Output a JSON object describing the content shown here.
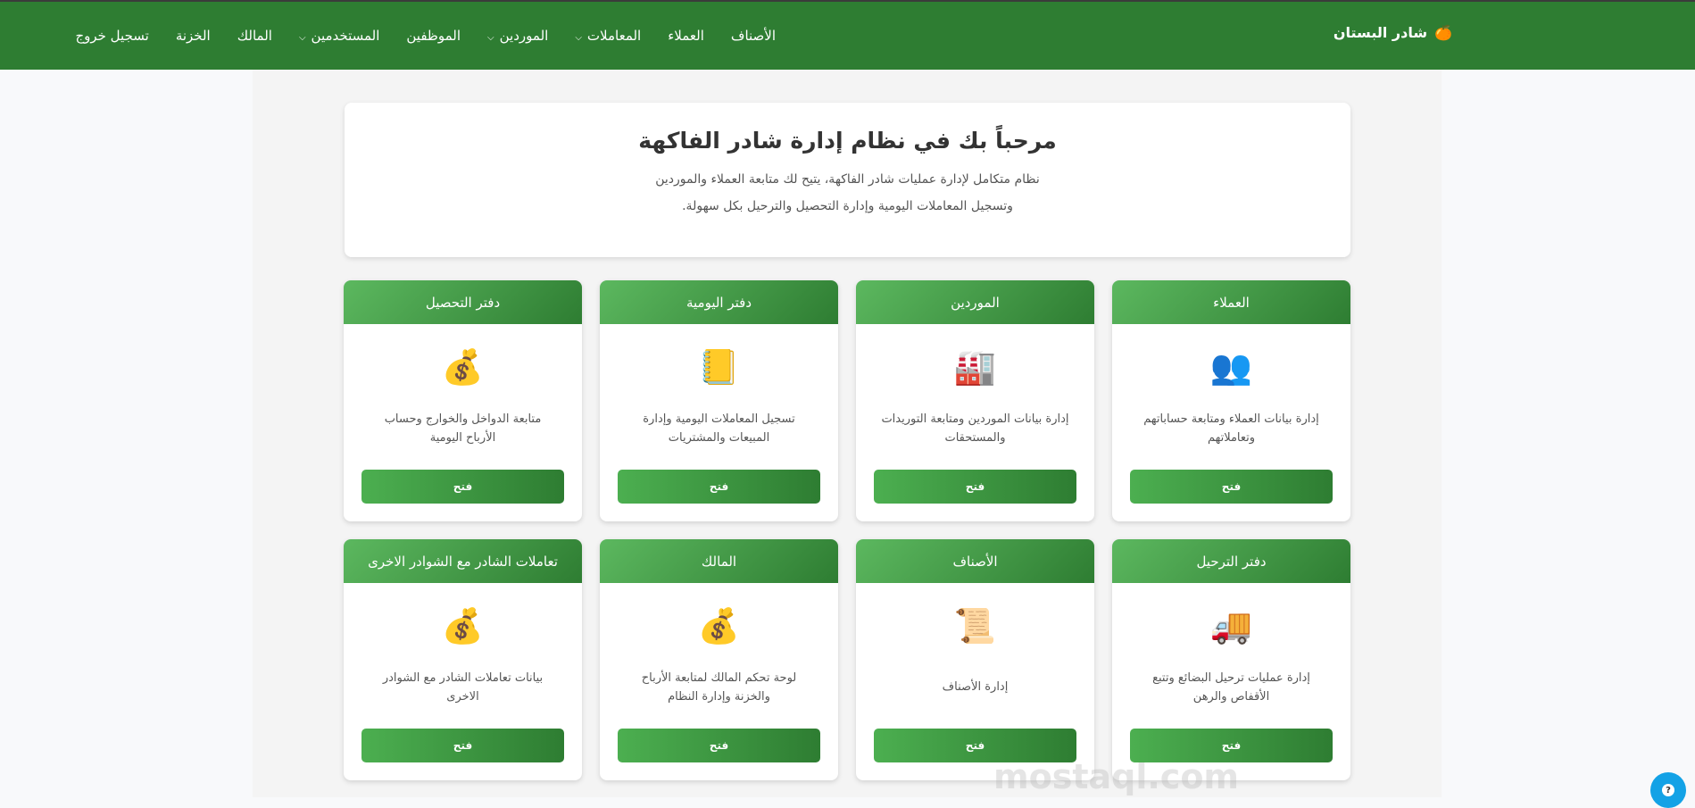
{
  "brand": {
    "icon": "🍊",
    "name": "شادر البستان"
  },
  "nav": [
    "الأصناف",
    "العملاء",
    "المعاملات",
    "الموردين",
    "الموظفين",
    "المستخدمين",
    "المالك",
    "الخزنة",
    "تسجيل خروج"
  ],
  "welcome": {
    "title": "مرحباً بك في نظام إدارة شادر الفاكهة",
    "line1": "نظام متكامل لإدارة عمليات شادر الفاكهة، يتيح لك متابعة العملاء والموردين",
    "line2": "وتسجيل المعاملات اليومية وإدارة التحصيل والترحيل بكل سهولة."
  },
  "cards": [
    {
      "title": "العملاء",
      "icon": "👥",
      "desc": "إدارة بيانات العملاء ومتابعة حساباتهم وتعاملاتهم",
      "button": "فتح"
    },
    {
      "title": "الموردين",
      "icon": "🏭",
      "desc": "إدارة بيانات الموردين ومتابعة التوريدات والمستحقات",
      "button": "فتح"
    },
    {
      "title": "دفتر اليومية",
      "icon": "📒",
      "desc": "تسجيل المعاملات اليومية وإدارة المبيعات والمشتريات",
      "button": "فتح"
    },
    {
      "title": "دفتر التحصيل",
      "icon": "💰",
      "desc": "متابعة الدواخل والخوارج وحساب الأرباح اليومية",
      "button": "فتح"
    },
    {
      "title": "دفتر الترحيل",
      "icon": "🚚",
      "desc": "إدارة عمليات ترحيل البضائع وتتبع الأقفاص والرهن",
      "button": "فتح"
    },
    {
      "title": "الأصناف",
      "icon": "📜",
      "desc": "إدارة الأصناف",
      "button": "فتح"
    },
    {
      "title": "المالك",
      "icon": "💰",
      "desc": "لوحة تحكم المالك لمتابعة الأرباح والخزنة وإدارة النظام",
      "button": "فتح"
    },
    {
      "title": "تعاملات الشادر مع الشوادر الاخرى",
      "icon": "💰",
      "desc": "بيانات تعاملات الشادر مع الشوادر الاخرى",
      "button": "فتح"
    }
  ],
  "help": "?",
  "watermark": "mostaql.com"
}
